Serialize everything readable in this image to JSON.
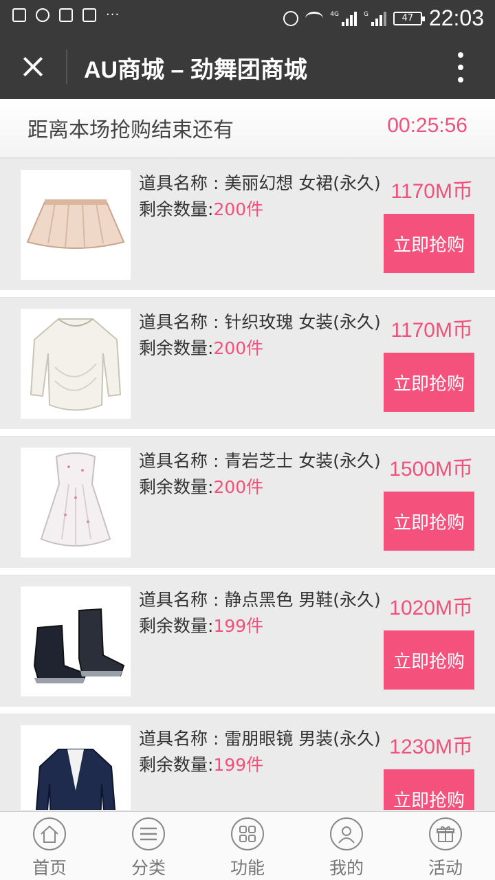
{
  "status_bar": {
    "time": "22:03",
    "battery": "47",
    "more": "···",
    "sim1": "4G",
    "sim2": "G"
  },
  "header": {
    "title": "AU商城 – 劲舞团商城"
  },
  "countdown": {
    "label": "距离本场抢购结束还有",
    "time": "00:25:56"
  },
  "items": [
    {
      "name": "道具名称 : 美丽幻想 女裙(永久)",
      "qty_label": "剩余数量:",
      "qty": "200件",
      "price": "1170M币",
      "button": "立即抢购",
      "image": "skirt"
    },
    {
      "name": "道具名称 : 针织玫瑰 女装(永久)",
      "qty_label": "剩余数量:",
      "qty": "200件",
      "price": "1170M币",
      "button": "立即抢购",
      "image": "knit-top"
    },
    {
      "name": "道具名称 : 青岩芝士 女装(永久)",
      "qty_label": "剩余数量:",
      "qty": "200件",
      "price": "1500M币",
      "button": "立即抢购",
      "image": "dress"
    },
    {
      "name": "道具名称 : 静点黑色 男鞋(永久)",
      "qty_label": "剩余数量:",
      "qty": "199件",
      "price": "1020M币",
      "button": "立即抢购",
      "image": "shoes"
    },
    {
      "name": "道具名称 : 雷朋眼镜 男装(永久)",
      "qty_label": "剩余数量:",
      "qty": "199件",
      "price": "1230M币",
      "button": "立即抢购",
      "image": "jacket"
    }
  ],
  "nav": [
    {
      "label": "首页",
      "icon": "home-icon"
    },
    {
      "label": "分类",
      "icon": "menu-icon"
    },
    {
      "label": "功能",
      "icon": "grid-icon"
    },
    {
      "label": "我的",
      "icon": "user-icon"
    },
    {
      "label": "活动",
      "icon": "gift-icon"
    }
  ],
  "colors": {
    "accent": "#f4527c",
    "price": "#f0507a",
    "titlebar": "#3a3a3a"
  }
}
